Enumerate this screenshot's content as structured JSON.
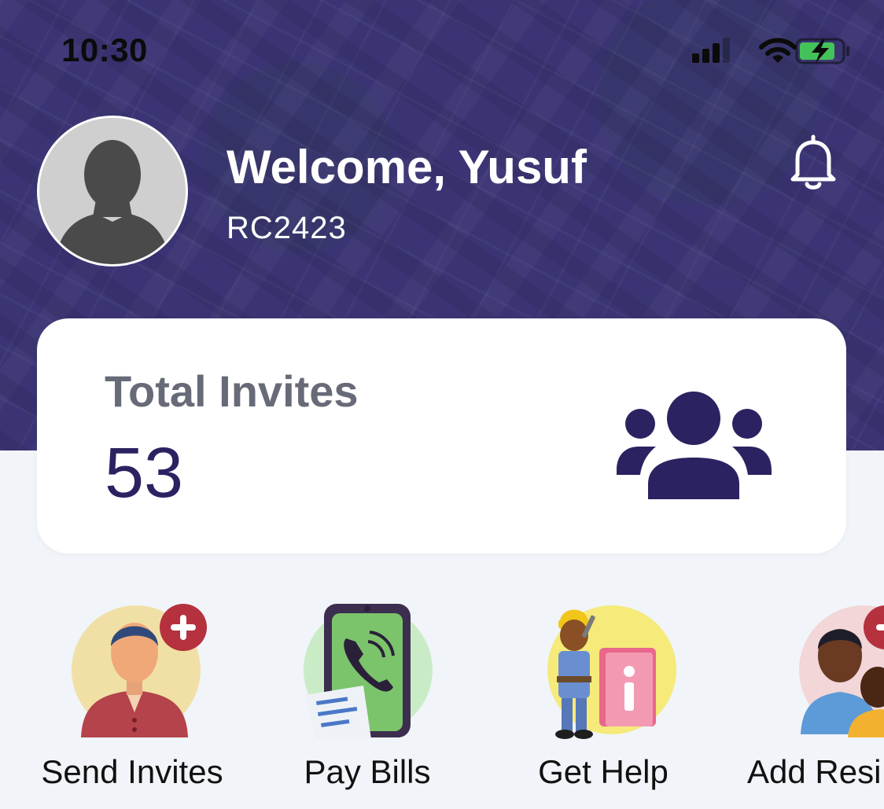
{
  "status_bar": {
    "time": "10:30",
    "icons": [
      "cellular-signal-icon",
      "wifi-icon",
      "battery-charging-icon"
    ]
  },
  "header": {
    "welcome": "Welcome, Yusuf",
    "member_id": "RC2423",
    "avatar_icon": "user-silhouette-icon",
    "notification_icon": "bell-icon"
  },
  "summary_card": {
    "title": "Total Invites",
    "count": "53",
    "icon": "users-group-icon"
  },
  "quick_actions": [
    {
      "label": "Send Invites",
      "icon": "send-invites-illustration"
    },
    {
      "label": "Pay Bills",
      "icon": "pay-bills-illustration"
    },
    {
      "label": "Get Help",
      "icon": "get-help-illustration"
    },
    {
      "label": "Add Resi",
      "icon": "add-resident-illustration"
    }
  ],
  "colors": {
    "header_overlay": "#3e3a72",
    "accent": "#2b2261",
    "page_background": "#f1f4f8",
    "card_title": "#676b78"
  }
}
